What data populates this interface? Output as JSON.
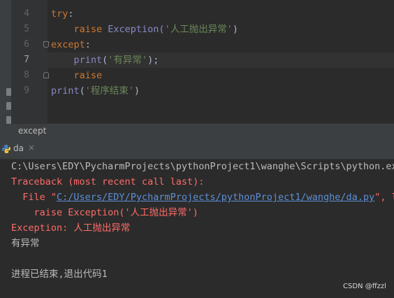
{
  "editor": {
    "line_numbers": [
      "4",
      "5",
      "6",
      "7",
      "8",
      "9"
    ],
    "code": {
      "l4_kw": "try",
      "l4_p": ":",
      "l5_ind": "    ",
      "l5_kw": "raise",
      "l5_fn": " Exception(",
      "l5_str": "'人工抛出异常'",
      "l5_p": ")",
      "l6_kw": "except",
      "l6_p": ":",
      "l7_ind": "    ",
      "l7_fn": "print",
      "l7_p1": "(",
      "l7_str": "'有异常'",
      "l7_p2": ");",
      "l8_ind": "    ",
      "l8_kw": "raise",
      "l9_fn": "print",
      "l9_p1": "(",
      "l9_str": "'程序结束'",
      "l9_p2": ")"
    }
  },
  "breadcrumb": {
    "label": "except"
  },
  "run_tab": {
    "label": "da",
    "close": "×",
    "icon": "python-icon"
  },
  "console": {
    "cmd": "C:\\Users\\EDY\\PycharmProjects\\pythonProject1\\wanghe\\Scripts\\python.exe",
    "traceback": "Traceback (most recent call last):",
    "file_prefix": "  File \"",
    "file_link": "C:/Users/EDY/PycharmProjects/pythonProject1/wanghe/da.py",
    "file_suffix": "\", li",
    "raise_line": "    raise Exception('人工抛出异常')",
    "exception_line": "Exception: 人工抛出异常",
    "stdout_line": "有异常",
    "exit_line": "进程已结束,退出代码1"
  },
  "watermark": "CSDN @ffzzl",
  "colors": {
    "background": "#2b2b2b",
    "keyword": "#cc7832",
    "builtin": "#8888c6",
    "string": "#6a8759",
    "error": "#ff6b68",
    "link": "#5c8fd6"
  }
}
